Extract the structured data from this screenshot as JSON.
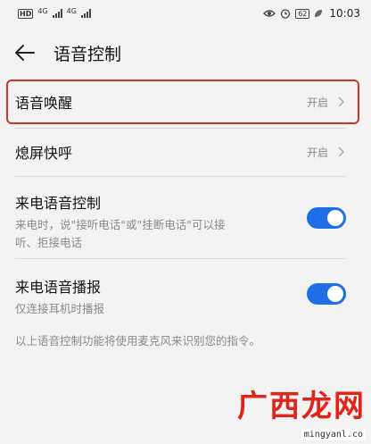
{
  "status_bar": {
    "hd_label": "HD",
    "signal1": "4G",
    "signal2": "4G",
    "battery": "62",
    "time": "10:03"
  },
  "header": {
    "title": "语音控制"
  },
  "rows": [
    {
      "title": "语音唤醒",
      "value": "开启"
    },
    {
      "title": "熄屏快呼",
      "value": "开启"
    }
  ],
  "toggles": [
    {
      "title": "来电语音控制",
      "desc_line1": "来电时，说\"接听电话\"或\"挂断电话\"可以接",
      "desc_line2": "听、拒接电话",
      "on": true
    },
    {
      "title": "来电语音播报",
      "desc_line1": "仅连接耳机时播报",
      "on": true
    }
  ],
  "footnote": "以上语音控制功能将使用麦克风来识别您的指令。",
  "watermark": {
    "logo_text": "广西龙网",
    "url": "mingyanl.co"
  },
  "colors": {
    "accent": "#1e6fe6",
    "highlight": "#c8362d",
    "watermark": "#e2231a"
  }
}
